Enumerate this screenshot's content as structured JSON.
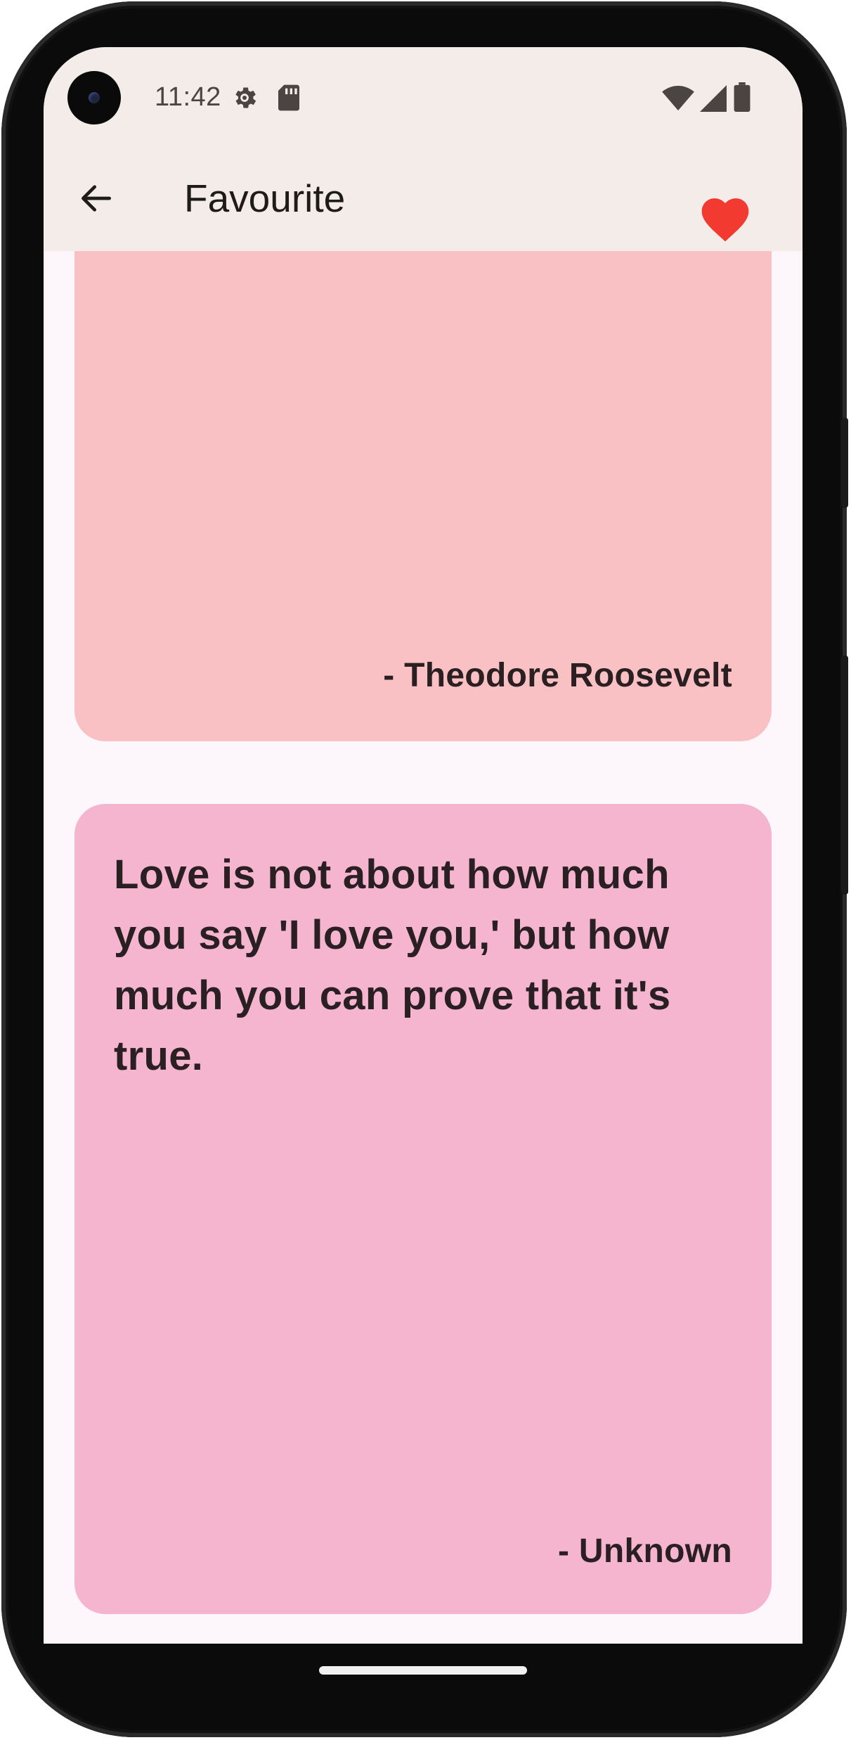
{
  "status_bar": {
    "time": "11:42",
    "icons": [
      "settings-gear-icon",
      "sd-card-icon",
      "wifi-icon",
      "cell-signal-icon",
      "battery-icon"
    ]
  },
  "app_bar": {
    "title": "Favourite",
    "back_icon": "arrow-left-icon",
    "action_icon": "heart-icon",
    "action_color": "#f23a30"
  },
  "cards": [
    {
      "quote": "",
      "author": "- Theodore Roosevelt",
      "color": "#f9c1c3"
    },
    {
      "quote": "Love is not about how much you say 'I love you,' but how much you can prove that it's true.",
      "author": "- Unknown",
      "color": "#f6b5ce"
    }
  ],
  "colors": {
    "app_bar_bg": "#f3ece9",
    "screen_bg": "#fdf7fb",
    "text": "#2a1f22"
  }
}
